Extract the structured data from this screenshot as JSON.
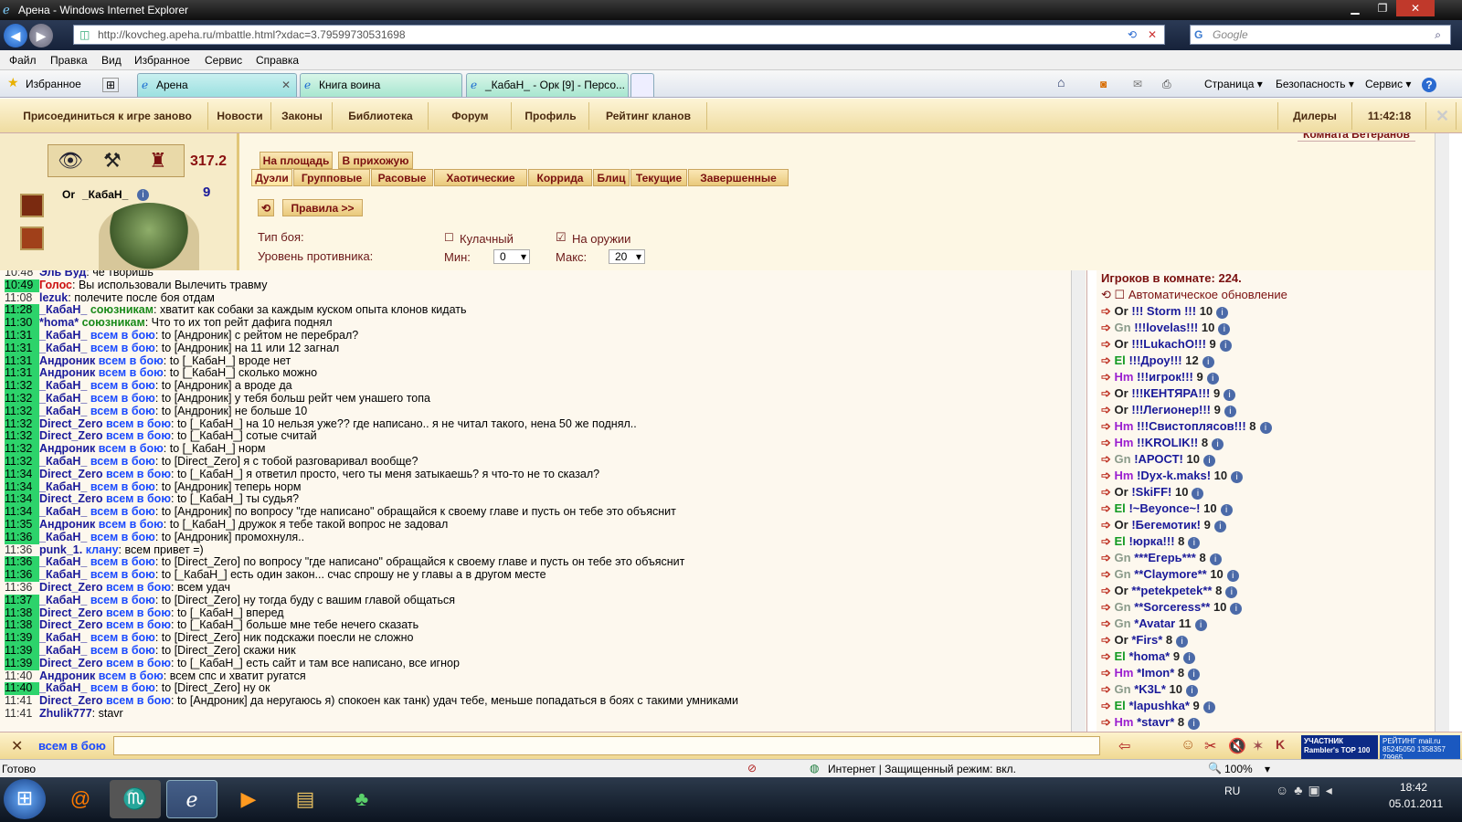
{
  "window": {
    "title": "Арена - Windows Internet Explorer"
  },
  "address": {
    "url": "http://kovcheg.apeha.ru/mbattle.html?xdac=3.79599730531698",
    "search_placeholder": "Google"
  },
  "menu": [
    "Файл",
    "Правка",
    "Вид",
    "Избранное",
    "Сервис",
    "Справка"
  ],
  "favorites_label": "Избранное",
  "tabs": [
    "Арена",
    "Книга воина",
    "_КабаН_ - Орк [9] - Персо..."
  ],
  "toolbar_right": [
    "Страница ▾",
    "Безопасность ▾",
    "Сервис ▾"
  ],
  "gamenav": {
    "items": [
      "Присоединиться к игре заново",
      "Новости",
      "Законы",
      "Библиотека",
      "Форум",
      "Профиль",
      "Рейтинг кланов"
    ],
    "dealers": "Дилеры",
    "clock": "11:42:18",
    "room": "Комната Ветеранов"
  },
  "character": {
    "score": "317.2",
    "level": "9",
    "race": "Or",
    "name": "_КабаН_"
  },
  "battle": {
    "top_tabs": [
      "На площадь",
      "В прихожую"
    ],
    "mode_tabs": [
      "Дуэли",
      "Групповые",
      "Расовые",
      "Хаотические",
      "Коррида",
      "Блиц",
      "Текущие",
      "Завершенные"
    ],
    "rules": "Правила >>",
    "fight_type_label": "Тип боя:",
    "opt_fist": "Кулачный",
    "opt_weapon": "На оружии",
    "opponent_label": "Уровень противника:",
    "min_label": "Мин:",
    "min_value": "0",
    "max_label": "Макс:",
    "max_value": "20"
  },
  "chat": [
    {
      "t": "10:48",
      "g": false,
      "nick": "Эль Вуд",
      "red": false,
      "chan": "",
      "text": ": че творишь"
    },
    {
      "t": "10:49",
      "g": true,
      "nick": "Голос",
      "red": true,
      "chan": "",
      "text": ": Вы использовали Вылечить травму"
    },
    {
      "t": "11:08",
      "g": false,
      "nick": "lezuk",
      "red": false,
      "chan": "",
      "text": ": полечите после боя отдам"
    },
    {
      "t": "11:28",
      "g": true,
      "nick": "_КабаН_",
      "red": false,
      "chan": "союзникам",
      "cg": true,
      "text": ": хватит как собаки за каждым куском опыта клонов кидать"
    },
    {
      "t": "11:30",
      "g": true,
      "nick": "*homa*",
      "red": false,
      "chan": "союзникам",
      "cg": true,
      "text": ": Что то их топ рейт дафига поднял"
    },
    {
      "t": "11:31",
      "g": true,
      "nick": "_КабаН_",
      "red": false,
      "chan": "всем в бою",
      "text": ": to [Андроник] с рейтом не перебрал?"
    },
    {
      "t": "11:31",
      "g": true,
      "nick": "_КабаН_",
      "red": false,
      "chan": "всем в бою",
      "text": ": to [Андроник] на 11 или 12 загнал"
    },
    {
      "t": "11:31",
      "g": true,
      "nick": "Андроник",
      "red": false,
      "chan": "всем в бою",
      "text": ": to [_КабаН_] вроде нет"
    },
    {
      "t": "11:31",
      "g": true,
      "nick": "Андроник",
      "red": false,
      "chan": "всем в бою",
      "text": ": to [_КабаН_] сколько можно"
    },
    {
      "t": "11:32",
      "g": true,
      "nick": "_КабаН_",
      "red": false,
      "chan": "всем в бою",
      "text": ": to [Андроник] а вроде да"
    },
    {
      "t": "11:32",
      "g": true,
      "nick": "_КабаН_",
      "red": false,
      "chan": "всем в бою",
      "text": ": to [Андроник] у тебя больш рейт чем унашего топа"
    },
    {
      "t": "11:32",
      "g": true,
      "nick": "_КабаН_",
      "red": false,
      "chan": "всем в бою",
      "text": ": to [Андроник] не больше 10"
    },
    {
      "t": "11:32",
      "g": true,
      "nick": "Direct_Zero",
      "red": false,
      "chan": "всем в бою",
      "text": ": to [_КабаН_] на 10 нельзя уже?? где написано.. я не читал такого, нена 50 же поднял.."
    },
    {
      "t": "11:32",
      "g": true,
      "nick": "Direct_Zero",
      "red": false,
      "chan": "всем в бою",
      "text": ": to [_КабаН_] сотые считай"
    },
    {
      "t": "11:32",
      "g": true,
      "nick": "Андроник",
      "red": false,
      "chan": "всем в бою",
      "text": ": to [_КабаН_] норм"
    },
    {
      "t": "11:32",
      "g": true,
      "nick": "_КабаН_",
      "red": false,
      "chan": "всем в бою",
      "text": ": to [Direct_Zero] я с тобой разговаривал вообще?"
    },
    {
      "t": "11:34",
      "g": true,
      "nick": "Direct_Zero",
      "red": false,
      "chan": "всем в бою",
      "text": ": to [_КабаН_] я ответил просто, чего ты меня затыкаешь? я что-то не то сказал?"
    },
    {
      "t": "11:34",
      "g": true,
      "nick": "_КабаН_",
      "red": false,
      "chan": "всем в бою",
      "text": ": to [Андроник] теперь норм"
    },
    {
      "t": "11:34",
      "g": true,
      "nick": "Direct_Zero",
      "red": false,
      "chan": "всем в бою",
      "text": ": to [_КабаН_] ты судья?"
    },
    {
      "t": "11:34",
      "g": true,
      "nick": "_КабаН_",
      "red": false,
      "chan": "всем в бою",
      "text": ": to [Андроник] по вопросу \"где написано\" обращайся к своему главе и пусть он тебе это объяснит"
    },
    {
      "t": "11:35",
      "g": true,
      "nick": "Андроник",
      "red": false,
      "chan": "всем в бою",
      "text": ": to [_КабаН_] дружок я тебе такой вопрос не задовал"
    },
    {
      "t": "11:36",
      "g": true,
      "nick": "_КабаН_",
      "red": false,
      "chan": "всем в бою",
      "text": ": to [Андроник] промохнуля.."
    },
    {
      "t": "11:36",
      "g": false,
      "nick": "punk_1.",
      "red": false,
      "chan": "клану",
      "text": ": всем привет =)"
    },
    {
      "t": "11:36",
      "g": true,
      "nick": "_КабаН_",
      "red": false,
      "chan": "всем в бою",
      "text": ": to [Direct_Zero] по вопросу \"где написано\" обращайся к своему главе и пусть он тебе это объяснит"
    },
    {
      "t": "11:36",
      "g": true,
      "nick": "_КабаН_",
      "red": false,
      "chan": "всем в бою",
      "text": ": to [_КабаН_] есть один закон... счас спрошу не у главы а в другом месте"
    },
    {
      "t": "11:36",
      "g": false,
      "nick": "Direct_Zero",
      "red": false,
      "chan": "всем в бою",
      "text": ": всем удач"
    },
    {
      "t": "11:37",
      "g": true,
      "nick": "_КабаН_",
      "red": false,
      "chan": "всем в бою",
      "text": ": to [Direct_Zero] ну тогда буду с вашим главой общаться"
    },
    {
      "t": "11:38",
      "g": true,
      "nick": "Direct_Zero",
      "red": false,
      "chan": "всем в бою",
      "text": ": to [_КабаН_] вперед"
    },
    {
      "t": "11:38",
      "g": true,
      "nick": "Direct_Zero",
      "red": false,
      "chan": "всем в бою",
      "text": ": to [_КабаН_] больше мне тебе нечего сказать"
    },
    {
      "t": "11:39",
      "g": true,
      "nick": "_КабаН_",
      "red": false,
      "chan": "всем в бою",
      "text": ": to [Direct_Zero] ник подскажи поесли не сложно"
    },
    {
      "t": "11:39",
      "g": true,
      "nick": "_КабаН_",
      "red": false,
      "chan": "всем в бою",
      "text": ": to [Direct_Zero] скажи ник"
    },
    {
      "t": "11:39",
      "g": true,
      "nick": "Direct_Zero",
      "red": false,
      "chan": "всем в бою",
      "text": ": to [_КабаН_] есть сайт и там все написано, все игнор"
    },
    {
      "t": "11:40",
      "g": false,
      "nick": "Андроник",
      "red": false,
      "chan": "всем в бою",
      "text": ": всем спс и хватит ругатся"
    },
    {
      "t": "11:40",
      "g": true,
      "nick": "_КабаН_",
      "red": false,
      "chan": "всем в бою",
      "text": ": to [Direct_Zero] ну ок"
    },
    {
      "t": "11:41",
      "g": false,
      "nick": "Direct_Zero",
      "red": false,
      "chan": "всем в бою",
      "text": ": to [Андроник] да неругаюсь я) спокоен как танк) удач тебе, меньше попадаться в боях с такими умниками"
    },
    {
      "t": "11:41",
      "g": false,
      "nick": "Zhulik777",
      "red": false,
      "chan": "",
      "text": ": stavr"
    }
  ],
  "players": {
    "header": "Игроков в комнате: 224.",
    "auto": "Автоматическое обновление",
    "list": [
      {
        "race": "Or",
        "cls": "or",
        "name": "!!! Storm !!!",
        "lvl": "10"
      },
      {
        "race": "Gn",
        "cls": "gn",
        "name": "!!!lovelas!!!",
        "lvl": "10"
      },
      {
        "race": "Or",
        "cls": "or",
        "name": "!!!LukachO!!!",
        "lvl": "9"
      },
      {
        "race": "El",
        "cls": "el",
        "name": "!!!Дроу!!!",
        "lvl": "12"
      },
      {
        "race": "Hm",
        "cls": "hm",
        "name": "!!!игрок!!!",
        "lvl": "9"
      },
      {
        "race": "Or",
        "cls": "or",
        "name": "!!!КЕНТЯРА!!!",
        "lvl": "9"
      },
      {
        "race": "Or",
        "cls": "or",
        "name": "!!!Легионер!!!",
        "lvl": "9"
      },
      {
        "race": "Hm",
        "cls": "hm",
        "name": "!!!Свистоплясов!!!",
        "lvl": "8"
      },
      {
        "race": "Hm",
        "cls": "hm",
        "name": "!!KROLIK!!",
        "lvl": "8"
      },
      {
        "race": "Gn",
        "cls": "gn",
        "name": "!АРОСТ!",
        "lvl": "10"
      },
      {
        "race": "Hm",
        "cls": "hm",
        "name": "!Dyx-k.maks!",
        "lvl": "10"
      },
      {
        "race": "Or",
        "cls": "or",
        "name": "!SkiFF!",
        "lvl": "10"
      },
      {
        "race": "El",
        "cls": "el",
        "name": "!~Beyonce~!",
        "lvl": "10"
      },
      {
        "race": "Or",
        "cls": "or",
        "name": "!Бегемотик!",
        "lvl": "9"
      },
      {
        "race": "El",
        "cls": "el",
        "name": "!юрка!!!",
        "lvl": "8"
      },
      {
        "race": "Gn",
        "cls": "gn",
        "name": "***Егерь***",
        "lvl": "8"
      },
      {
        "race": "Gn",
        "cls": "gn",
        "name": "**Claymore**",
        "lvl": "10"
      },
      {
        "race": "Or",
        "cls": "or",
        "name": "**petekpetek**",
        "lvl": "8"
      },
      {
        "race": "Gn",
        "cls": "gn",
        "name": "**Sorceress**",
        "lvl": "10"
      },
      {
        "race": "Gn",
        "cls": "gn",
        "name": "*Avatar",
        "lvl": "11"
      },
      {
        "race": "Or",
        "cls": "or",
        "name": "*Firs*",
        "lvl": "8"
      },
      {
        "race": "El",
        "cls": "el",
        "name": "*homa*",
        "lvl": "9"
      },
      {
        "race": "Hm",
        "cls": "hm",
        "name": "*Imon*",
        "lvl": "8"
      },
      {
        "race": "Gn",
        "cls": "gn",
        "name": "*K3L*",
        "lvl": "10"
      },
      {
        "race": "El",
        "cls": "el",
        "name": "*lapushka*",
        "lvl": "9"
      },
      {
        "race": "Hm",
        "cls": "hm",
        "name": "*stavr*",
        "lvl": "8"
      }
    ]
  },
  "input": {
    "channel": "всем в бою"
  },
  "badges": {
    "rambler": "УЧАСТНИК Rambler's TOP 100",
    "mail": "РЕЙТИНГ mail.ru",
    "mail_nums": "85245050 1358357 79965"
  },
  "status": {
    "ready": "Готово",
    "zone": "Интернет | Защищенный режим: вкл.",
    "zoom": "100%"
  },
  "taskbar": {
    "lang": "RU",
    "time": "18:42",
    "date": "05.01.2011"
  },
  "colors": {
    "accent": "#7a1010",
    "chat_time_bg": "#2dd36b",
    "nick": "#1a1a9a"
  }
}
